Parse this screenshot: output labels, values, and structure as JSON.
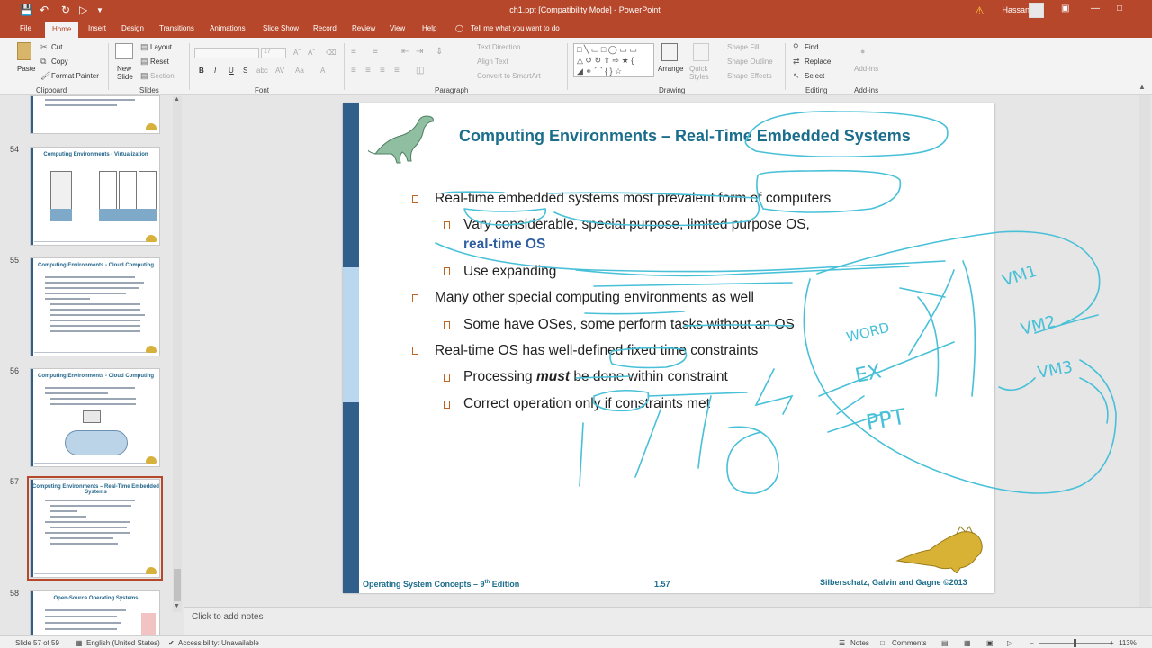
{
  "window": {
    "title": "ch1.ppt [Compatibility Mode]  -  PowerPoint",
    "user": "Hassan Ali",
    "tell_me": "Tell me what you want to do"
  },
  "tabs": [
    "File",
    "Home",
    "Insert",
    "Design",
    "Transitions",
    "Animations",
    "Slide Show",
    "Record",
    "Review",
    "View",
    "Help"
  ],
  "ribbon": {
    "clipboard": {
      "paste": "Paste",
      "cut": "Cut",
      "copy": "Copy",
      "format_painter": "Format Painter",
      "label": "Clipboard"
    },
    "slides": {
      "new_slide": "New Slide",
      "layout": "Layout",
      "reset": "Reset",
      "section": "Section",
      "label": "Slides"
    },
    "font": {
      "size": "17",
      "label": "Font"
    },
    "paragraph": {
      "text_direction": "Text Direction",
      "align_text": "Align Text",
      "convert_smartart": "Convert to SmartArt",
      "label": "Paragraph"
    },
    "drawing": {
      "arrange": "Arrange",
      "quick_styles": "Quick Styles",
      "shape_fill": "Shape Fill",
      "shape_outline": "Shape Outline",
      "shape_effects": "Shape Effects",
      "label": "Drawing"
    },
    "editing": {
      "find": "Find",
      "replace": "Replace",
      "select": "Select",
      "label": "Editing"
    },
    "addins": {
      "addins": "Add-ins",
      "label": "Add-ins"
    }
  },
  "thumbnails": [
    {
      "number": "",
      "title": ""
    },
    {
      "number": "54",
      "title": "Computing  Environments  - Virtualization"
    },
    {
      "number": "55",
      "title": "Computing  Environments  - Cloud Computing"
    },
    {
      "number": "56",
      "title": "Computing  Environments  - Cloud Computing"
    },
    {
      "number": "57",
      "title": "Computing Environments – Real-Time Embedded Systems"
    },
    {
      "number": "58",
      "title": "Open-Source  Operating  Systems"
    }
  ],
  "slide": {
    "title": "Computing Environments – Real-Time Embedded Systems",
    "bullets": [
      "Real-time embedded systems most prevalent form of computers",
      "Vary considerable, special purpose, limited purpose OS,",
      "real-time OS",
      "Use expanding",
      "Many other special computing environments as well",
      "Some have OSes, some perform tasks without an OS",
      "Real-time OS has well-defined fixed time constraints",
      "Processing",
      "must",
      "be done within constraint",
      "Correct operation only if constraints met"
    ],
    "footer_left": "Operating System Concepts – 9",
    "footer_sup": "th",
    "footer_left_end": " Edition",
    "footer_center": "1.57",
    "footer_right": "Silberschatz, Galvin and Gagne ©2013"
  },
  "ink_labels": [
    "VM1",
    "VM2",
    "VM3",
    "WORD",
    "EX",
    "PPT"
  ],
  "notes_placeholder": "Click to add notes",
  "status": {
    "slide": "Slide 57 of 59",
    "language": "English (United States)",
    "accessibility": "Accessibility: Unavailable",
    "notes": "Notes",
    "comments": "Comments",
    "zoom": "113%"
  },
  "colors": {
    "accent": "#b7472a",
    "slide_title": "#1b6d8c",
    "ink": "#48c0d8",
    "bullet": "#c0641f"
  }
}
